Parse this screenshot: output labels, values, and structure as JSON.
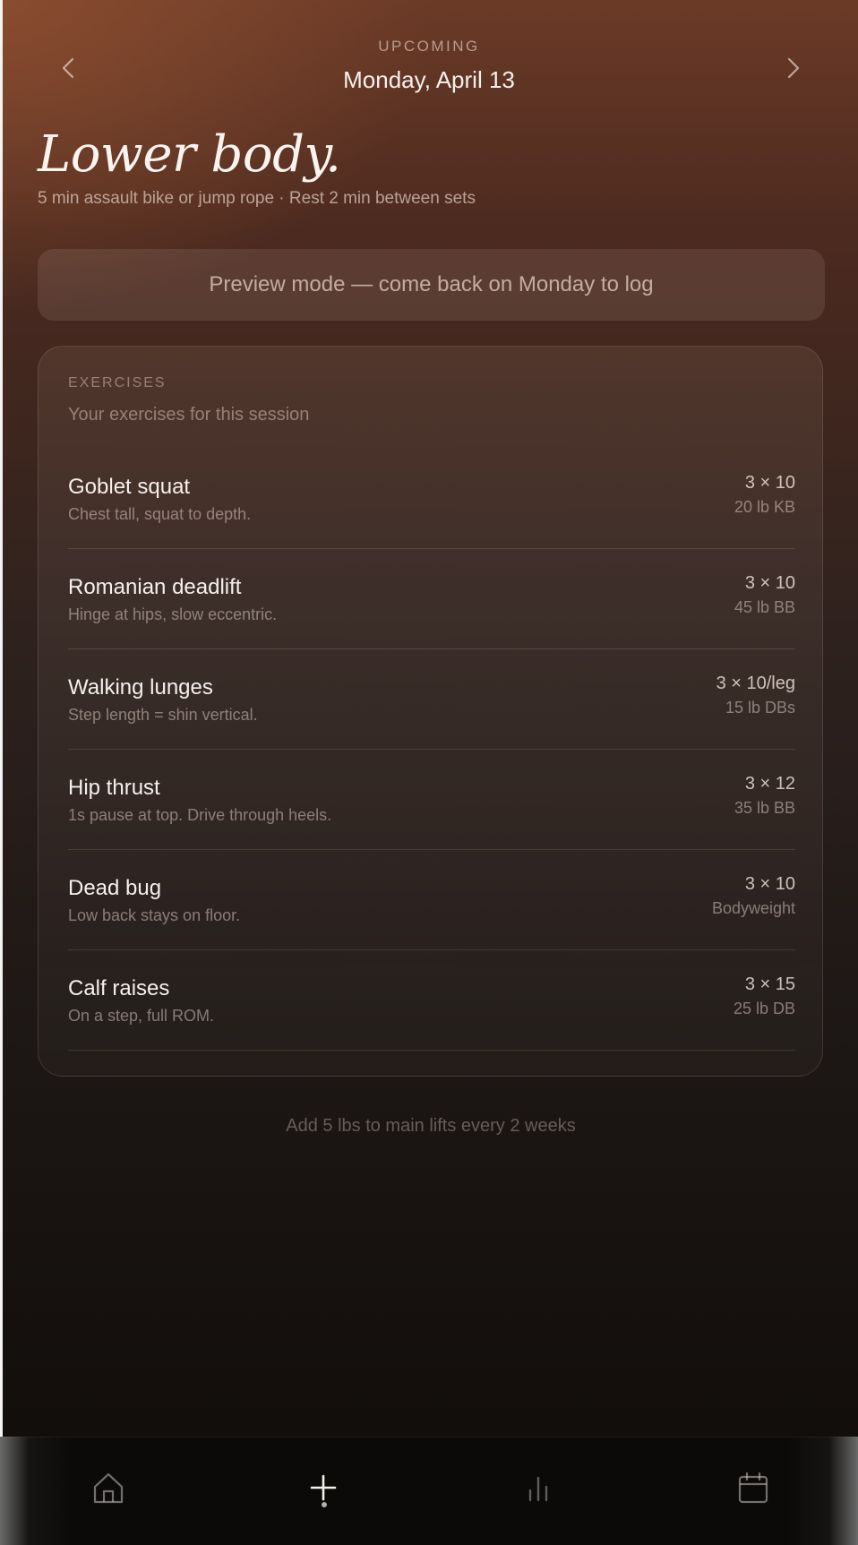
{
  "header": {
    "kicker": "UPCOMING",
    "date": "Monday, April 13",
    "prev_icon": "chevron-left-icon",
    "next_icon": "chevron-right-icon"
  },
  "workout": {
    "title": "Lower body.",
    "subtitle": "5 min assault bike or jump rope · Rest 2 min between sets"
  },
  "preview_banner": {
    "text": "Preview mode — come back on Monday to log"
  },
  "exercises_card": {
    "label": "EXERCISES",
    "subtitle": "Your exercises for this session",
    "items": [
      {
        "name": "Goblet squat",
        "note": "Chest tall, squat to depth.",
        "sets": "3 × 10",
        "load": "20 lb KB"
      },
      {
        "name": "Romanian deadlift",
        "note": "Hinge at hips, slow eccentric.",
        "sets": "3 × 10",
        "load": "45 lb BB"
      },
      {
        "name": "Walking lunges",
        "note": "Step length = shin vertical.",
        "sets": "3 × 10/leg",
        "load": "15 lb DBs"
      },
      {
        "name": "Hip thrust",
        "note": "1s pause at top. Drive through heels.",
        "sets": "3 × 12",
        "load": "35 lb BB"
      },
      {
        "name": "Dead bug",
        "note": "Low back stays on floor.",
        "sets": "3 × 10",
        "load": "Bodyweight"
      },
      {
        "name": "Calf raises",
        "note": "On a step, full ROM.",
        "sets": "3 × 15",
        "load": "25 lb DB"
      }
    ]
  },
  "progression_note": "Add 5 lbs to main lifts every 2 weeks",
  "tabbar": {
    "tabs": [
      {
        "icon": "home-icon",
        "active": false
      },
      {
        "icon": "plus-icon",
        "active": true
      },
      {
        "icon": "bar-chart-icon",
        "active": false
      },
      {
        "icon": "calendar-icon",
        "active": false
      }
    ]
  },
  "colors": {
    "background_top": "#6b3a27",
    "background_bottom": "#120e0c",
    "text_primary": "#f6f0ec",
    "text_muted": "#b3a39b"
  }
}
